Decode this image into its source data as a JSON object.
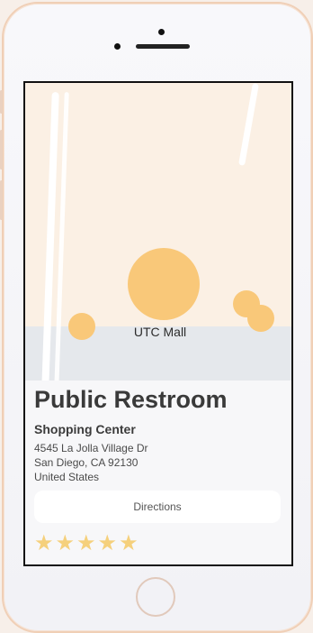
{
  "map": {
    "label": "UTC Mall",
    "colors": {
      "land": "#fbf0e4",
      "road": "#e5e8ec",
      "marker": "#f9c879"
    }
  },
  "place": {
    "title": "Public Restroom",
    "category": "Shopping Center",
    "address_line1": "4545 La Jolla Village Dr",
    "address_line2": "San Diego, CA 92130",
    "address_line3": "United States"
  },
  "actions": {
    "directions_label": "Directions"
  },
  "rating": {
    "stars": [
      "★",
      "★",
      "★",
      "★",
      "★"
    ],
    "value": 5,
    "max": 5
  },
  "icons": {
    "star": "star-icon",
    "home": "home-button-icon"
  }
}
